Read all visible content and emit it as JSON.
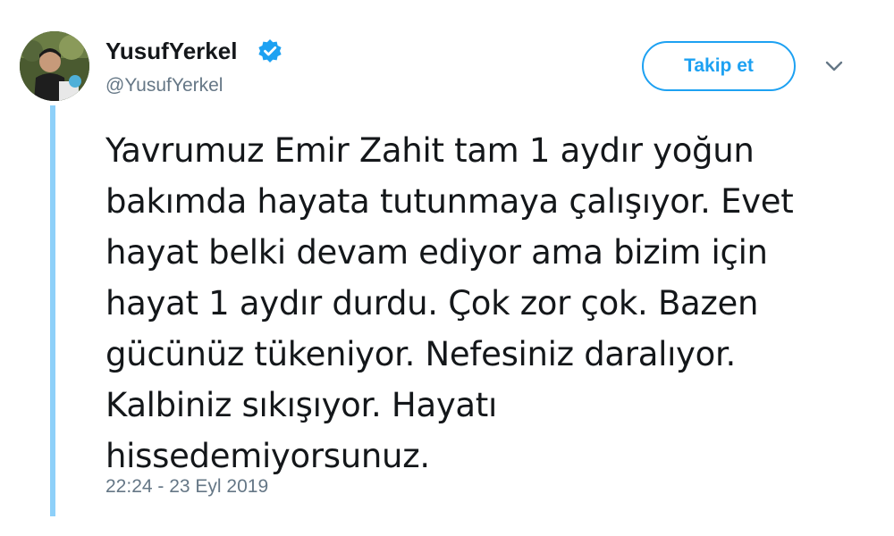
{
  "author": {
    "display_name": "YusufYerkel",
    "handle": "@YusufYerkel",
    "verified": true
  },
  "actions": {
    "follow_label": "Takip et"
  },
  "tweet": {
    "lines": [
      "Yavrumuz Emir Zahit tam 1 aydır yoğun",
      "bakımda hayata tutunmaya çalışıyor. Evet",
      "hayat belki devam ediyor ama bizim için",
      "hayat 1 aydır durdu. Çok zor çok. Bazen",
      "gücünüz tükeniyor. Nefesiniz daralıyor.",
      "Kalbiniz sıkışıyor. Hayatı",
      "hissedemiyorsunuz."
    ],
    "timestamp": "22:24 - 23 Eyl 2019"
  },
  "colors": {
    "accent": "#1da1f2",
    "thread_line": "#8ed0f9",
    "secondary_text": "#657786",
    "primary_text": "#14171a"
  },
  "icons": {
    "verified": "verified-badge-icon",
    "menu": "chevron-down-icon"
  }
}
